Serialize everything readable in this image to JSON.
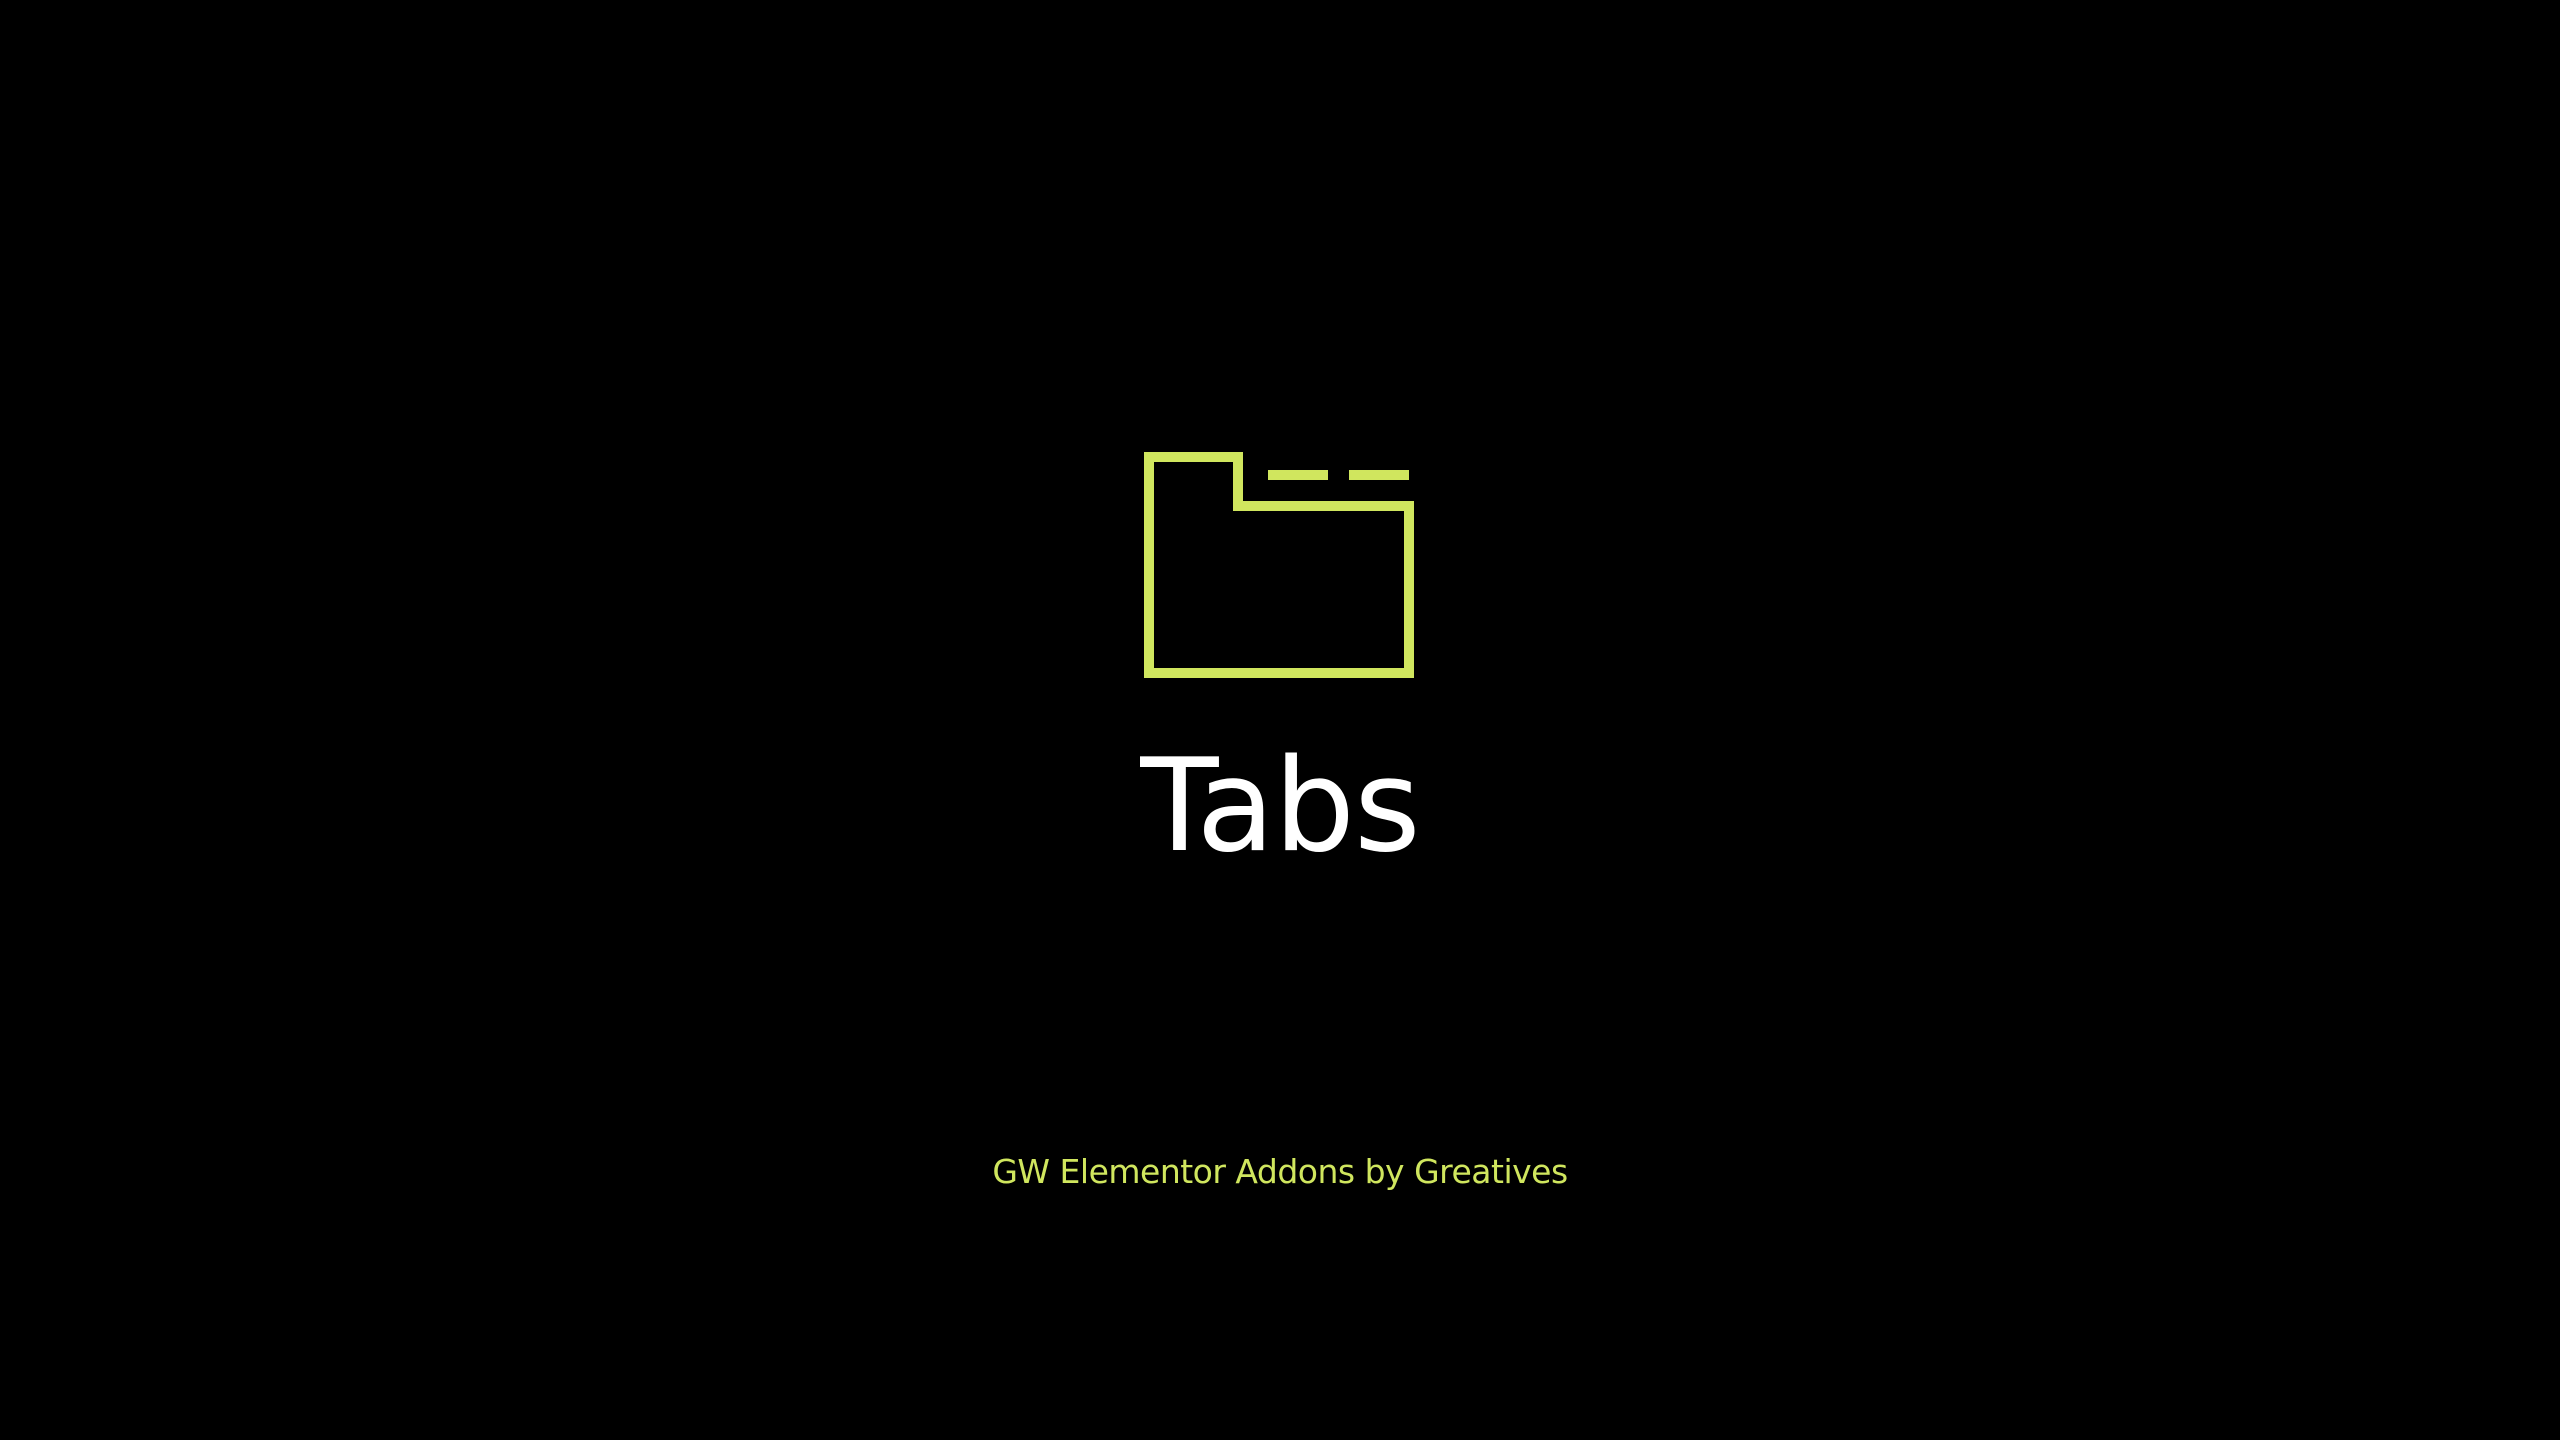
{
  "slide": {
    "icon": "folder-tabs-icon",
    "title": "Tabs",
    "credit": "GW Elementor Addons by Greatives"
  },
  "colors": {
    "background": "#000000",
    "accent": "#d0e65e",
    "title": "#ffffff"
  }
}
